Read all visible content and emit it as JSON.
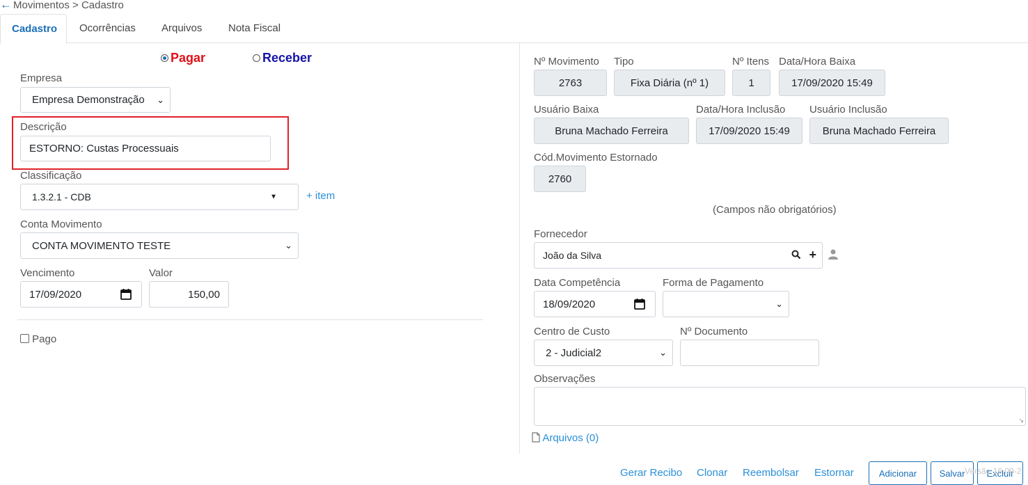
{
  "breadcrumb": {
    "back_icon": "arrow-left",
    "text": "Movimentos > Cadastro"
  },
  "tabs": [
    {
      "label": "Cadastro",
      "active": true
    },
    {
      "label": "Ocorrências",
      "active": false
    },
    {
      "label": "Arquivos",
      "active": false
    },
    {
      "label": "Nota Fiscal",
      "active": false
    }
  ],
  "left": {
    "radio_pagar": {
      "label": "Pagar",
      "selected": true,
      "color": "#e0101a"
    },
    "radio_receber": {
      "label": "Receber",
      "selected": false,
      "color": "#1414a8"
    },
    "empresa": {
      "label": "Empresa",
      "value": "Empresa Demonstração"
    },
    "descricao": {
      "label": "Descrição",
      "value": "ESTORNO: Custas Processuais"
    },
    "classificacao": {
      "label": "Classificação",
      "value": "1.3.2.1 - CDB",
      "add_item": "+ item"
    },
    "conta_movimento": {
      "label": "Conta Movimento",
      "value": "CONTA MOVIMENTO TESTE"
    },
    "vencimento": {
      "label": "Vencimento",
      "value": "17/09/2020"
    },
    "valor": {
      "label": "Valor",
      "value": "150,00"
    },
    "pago": {
      "label": "Pago",
      "checked": false
    }
  },
  "right": {
    "n_movimento": {
      "label": "Nº Movimento",
      "value": "2763"
    },
    "tipo": {
      "label": "Tipo",
      "value": "Fixa Diária (nº 1)"
    },
    "n_itens": {
      "label": "Nº Itens",
      "value": "1"
    },
    "data_hora_baixa": {
      "label": "Data/Hora Baixa",
      "value": "17/09/2020 15:49"
    },
    "usuario_baixa": {
      "label": "Usuário Baixa",
      "value": "Bruna Machado Ferreira"
    },
    "data_hora_inclusao": {
      "label": "Data/Hora Inclusão",
      "value": "17/09/2020 15:49"
    },
    "usuario_inclusao": {
      "label": "Usuário Inclusão",
      "value": "Bruna Machado Ferreira"
    },
    "cod_movimento_estornado": {
      "label": "Cód.Movimento Estornado",
      "value": "2760"
    },
    "campos_nao_obrigatorios": "(Campos não obrigatórios)",
    "fornecedor": {
      "label": "Fornecedor",
      "value": "João da Silva"
    },
    "data_competencia": {
      "label": "Data Competência",
      "value": "18/09/2020"
    },
    "forma_pagamento": {
      "label": "Forma de Pagamento",
      "value": ""
    },
    "centro_custo": {
      "label": "Centro de Custo",
      "value": "2 - Judicial2"
    },
    "n_documento": {
      "label": "Nº Documento",
      "value": ""
    },
    "observacoes": {
      "label": "Observações",
      "value": ""
    },
    "arquivos_link": "Arquivos (0)"
  },
  "footer": {
    "gerar_recibo": "Gerar Recibo",
    "clonar": "Clonar",
    "reembolsar": "Reembolsar",
    "estornar": "Estornar",
    "adicionar": "Adicionar",
    "salvar": "Salvar",
    "excluir": "Excluir",
    "versao": "Versão 16.09-2"
  },
  "colors": {
    "accent": "#1a6fb8",
    "link": "#2a8fd8",
    "highlight_border": "#e0202a",
    "readonly_bg": "#e9ecef"
  }
}
